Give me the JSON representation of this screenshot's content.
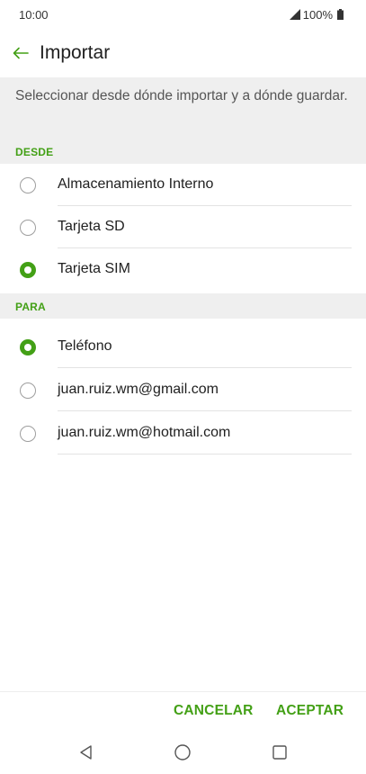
{
  "status_bar": {
    "time": "10:00",
    "battery": "100%"
  },
  "header": {
    "title": "Importar"
  },
  "description": "Seleccionar desde dónde importar y a dónde guardar.",
  "sections": {
    "desde": {
      "label": "DESDE",
      "options": [
        {
          "label": "Almacenamiento Interno",
          "selected": false
        },
        {
          "label": "Tarjeta SD",
          "selected": false
        },
        {
          "label": "Tarjeta SIM",
          "selected": true
        }
      ]
    },
    "para": {
      "label": "PARA",
      "options": [
        {
          "label": "Teléfono",
          "selected": true
        },
        {
          "label": "juan.ruiz.wm@gmail.com",
          "selected": false
        },
        {
          "label": "juan.ruiz.wm@hotmail.com",
          "selected": false
        }
      ]
    }
  },
  "actions": {
    "cancel": "CANCELAR",
    "accept": "ACEPTAR"
  },
  "colors": {
    "accent": "#43a016",
    "section_bg": "#efefef"
  },
  "icons": {
    "back": "arrow-left-icon",
    "signal": "signal-icon",
    "battery": "battery-icon",
    "nav_back": "triangle-back-icon",
    "nav_home": "circle-home-icon",
    "nav_recents": "square-recents-icon"
  }
}
